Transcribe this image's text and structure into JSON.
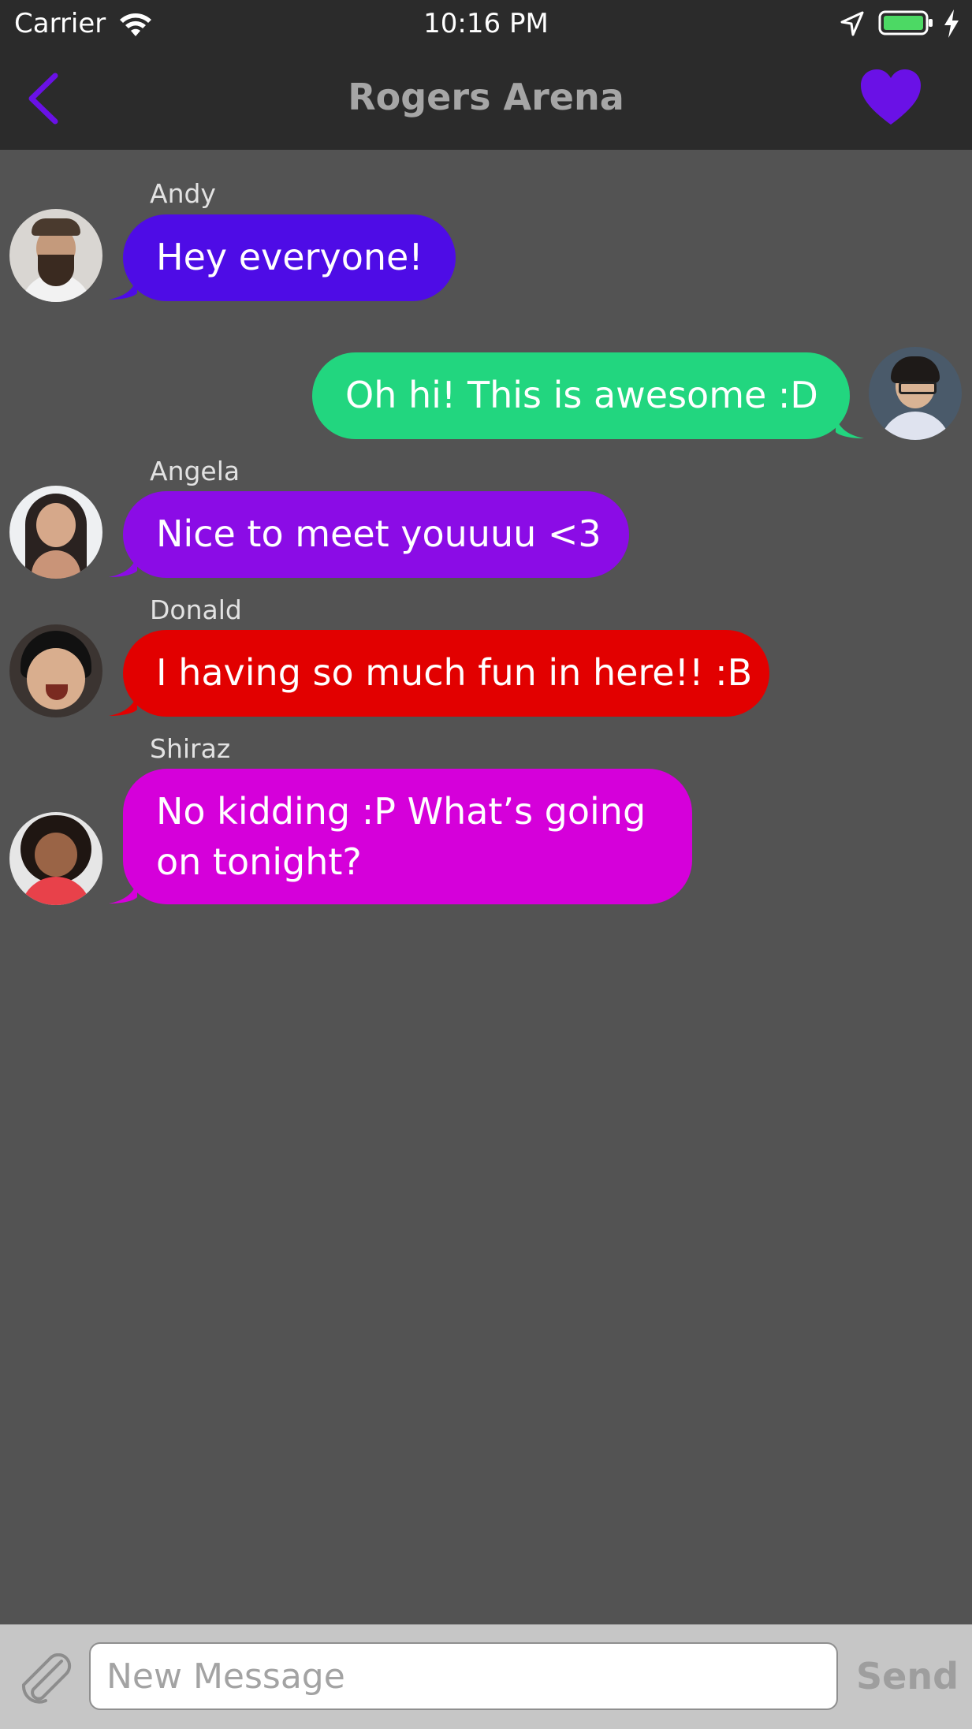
{
  "status_bar": {
    "carrier": "Carrier",
    "time": "10:16 PM",
    "icons": [
      "wifi-icon",
      "location-arrow-icon",
      "battery-icon",
      "charging-bolt-icon"
    ],
    "battery_color": "#4cd964"
  },
  "nav": {
    "title": "Rogers Arena",
    "back_icon": "chevron-left-icon",
    "favorite_icon": "heart-icon",
    "accent_color": "#6a11e6"
  },
  "messages": [
    {
      "sender": "Andy",
      "text": "Hey everyone!",
      "color": "#4e0ce6",
      "outgoing": false
    },
    {
      "sender": "",
      "text": "Oh hi! This is awesome :D",
      "color": "#22d67f",
      "outgoing": true
    },
    {
      "sender": "Angela",
      "text": "Nice to meet youuuu <3",
      "color": "#8b0ce6",
      "outgoing": false
    },
    {
      "sender": "Donald",
      "text": "I having so much fun in here!! :B",
      "color": "#e20000",
      "outgoing": false
    },
    {
      "sender": "Shiraz",
      "text_lines": [
        "No kidding :P What’s going",
        "on tonight?"
      ],
      "color": "#d500da",
      "outgoing": false
    }
  ],
  "composer": {
    "attach_icon": "paperclip-icon",
    "placeholder": "New Message",
    "value": "",
    "send_label": "Send"
  }
}
